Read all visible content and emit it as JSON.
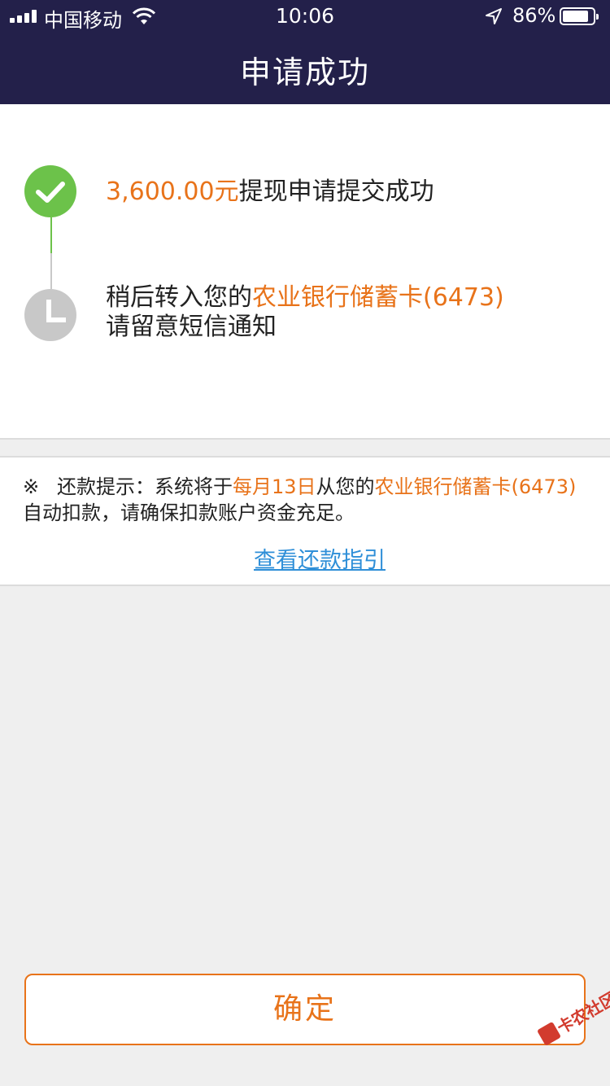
{
  "status_bar": {
    "carrier": "中国移动",
    "time": "10:06",
    "battery_percent": "86%",
    "battery_level": 0.86
  },
  "nav": {
    "title": "申请成功"
  },
  "steps": [
    {
      "amount": "3,600.00元",
      "text": "提现申请提交成功"
    },
    {
      "prefix": "稍后转入您的",
      "bank": "农业银行储蓄卡(6473)",
      "line2": "请留意短信通知"
    }
  ],
  "notice": {
    "mark": "※",
    "prefix": "还款提示：系统将于",
    "date": "每月13日",
    "middle": "从您的",
    "bank": "农业银行储蓄卡(6473)",
    "suffix": "自动扣款，请确保扣款账户资金充足。",
    "link": "查看还款指引"
  },
  "confirm_label": "确定",
  "watermark": "卡农社区",
  "colors": {
    "nav_bg": "#23204a",
    "accent": "#e8731a",
    "success": "#6cc24a",
    "link": "#2f8fd8"
  }
}
